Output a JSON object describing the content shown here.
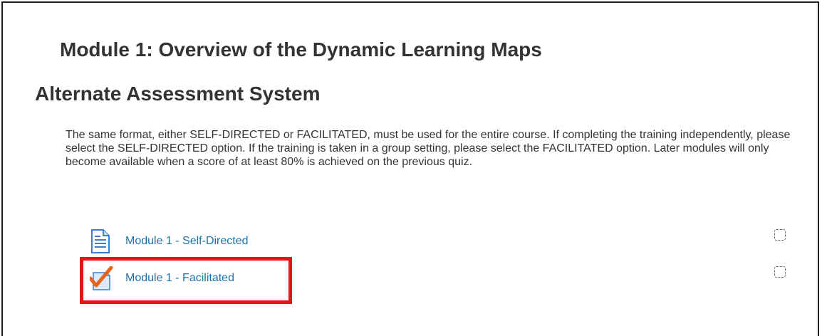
{
  "section": {
    "title_line1": "Module 1: Overview of the Dynamic Learning Maps",
    "title_line2": "Alternate Assessment System",
    "summary": "The same format, either SELF-DIRECTED or FACILITATED, must be used for the entire course. If completing the training independently, please select the SELF-DIRECTED option. If the training is taken in a group setting, please select the FACILITATED option. Later modules will only become available when a score of at least 80% is achieved on the previous quiz."
  },
  "activities": [
    {
      "label": "Module 1 - Self-Directed",
      "icon": "page-icon",
      "completion": "not-complete"
    },
    {
      "label": "Module 1 - Facilitated",
      "icon": "assignment-check-icon",
      "completion": "not-complete",
      "highlighted": true
    }
  ],
  "colors": {
    "link": "#1d73a8",
    "heading": "#333333",
    "highlight": "#e4141b",
    "icon_blue": "#3d7fcf",
    "check_orange": "#e8621a"
  }
}
